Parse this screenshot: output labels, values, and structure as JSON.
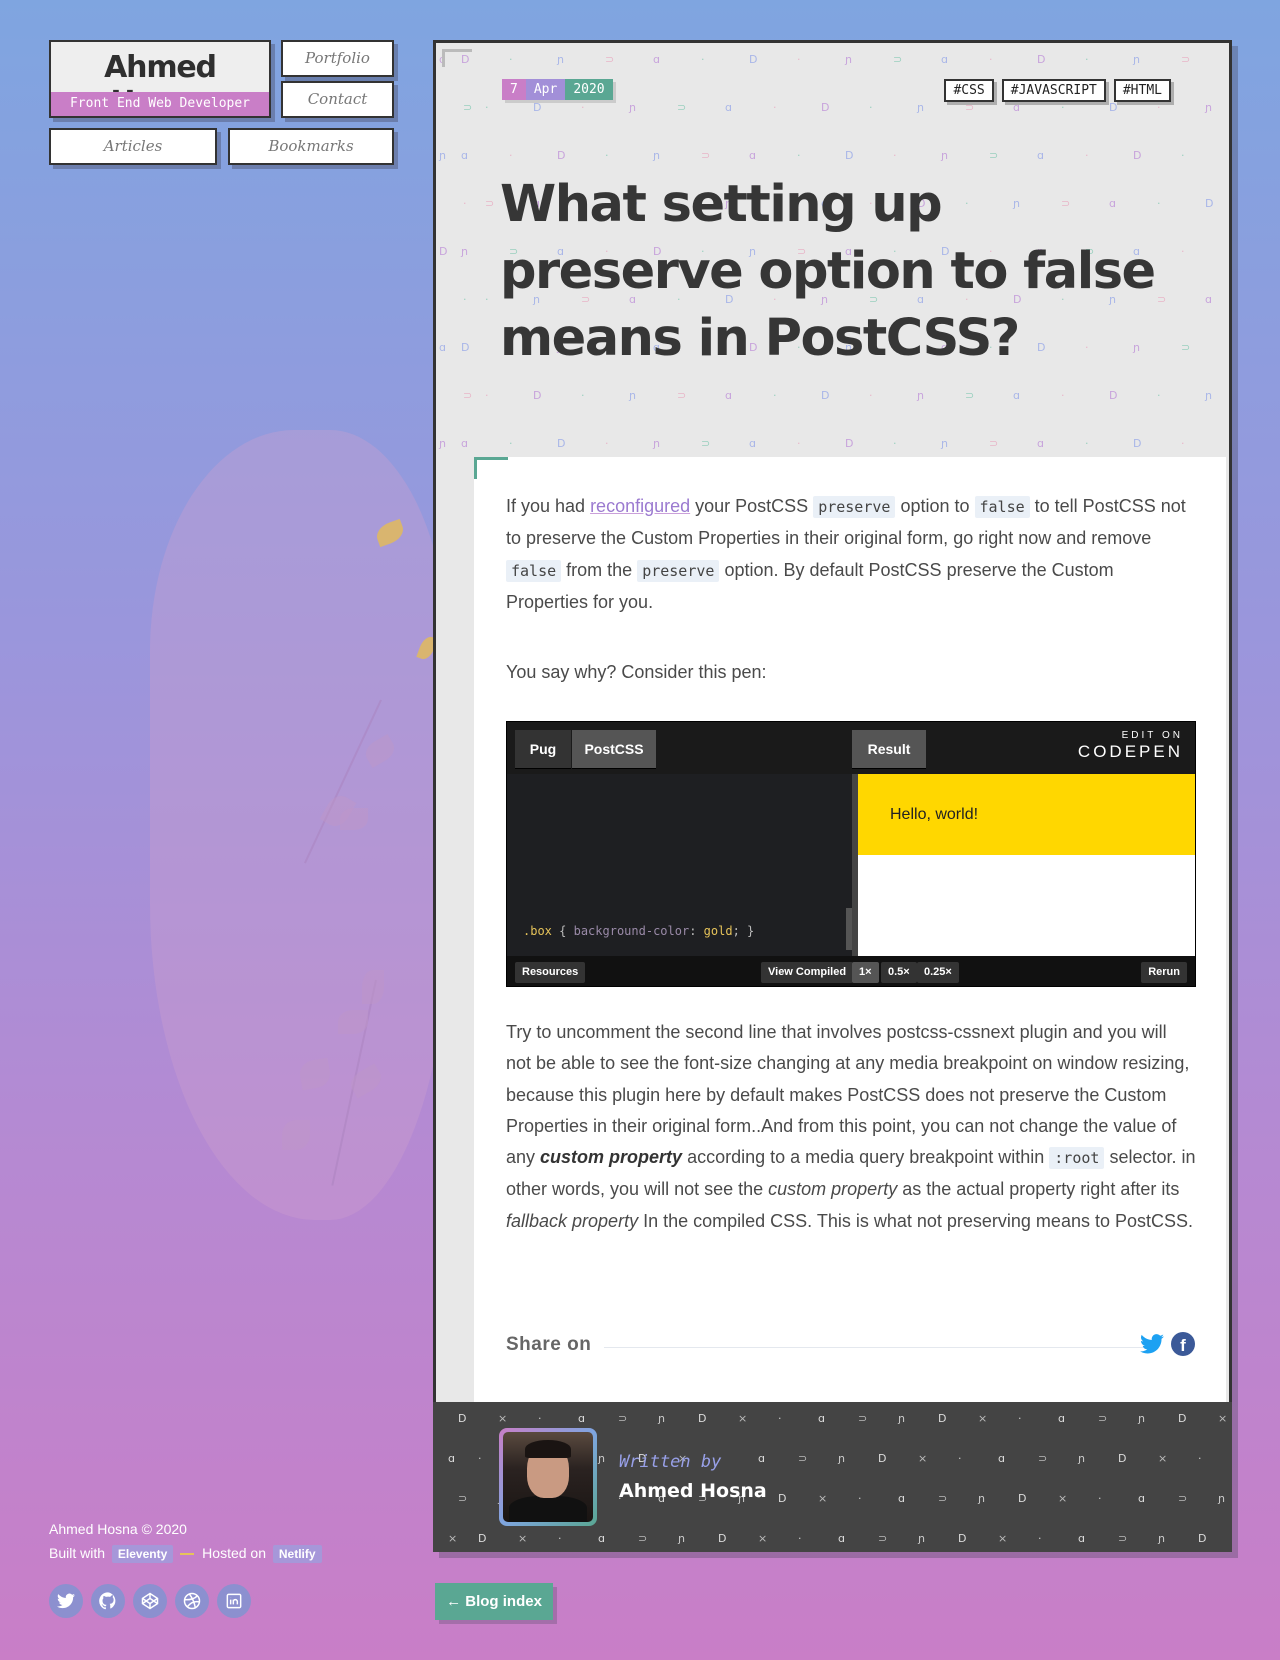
{
  "site": {
    "name": "Ahmed Hosna",
    "tagline": "Front End Web Developer",
    "nav": [
      "Portfolio",
      "Contact",
      "Articles",
      "Bookmarks"
    ]
  },
  "footer": {
    "copyright": "Ahmed Hosna © 2020",
    "built_with_label": "Built with",
    "built_with": "Eleventy",
    "hosted_label": "Hosted on",
    "hosted_on": "Netlify",
    "socials": [
      "twitter-icon",
      "github-icon",
      "codepen-icon",
      "dribbble-icon",
      "linkedin-icon"
    ]
  },
  "article": {
    "date": {
      "day": "7",
      "month": "Apr",
      "year": "2020"
    },
    "tags": [
      "#CSS",
      "#JAVASCRIPT",
      "#HTML"
    ],
    "title": "What setting up preserve option to false means in PostCSS?",
    "p1": {
      "a": "If you had ",
      "link": "reconfigured",
      "b": " your PostCSS ",
      "code1": "preserve",
      "c": " option to ",
      "code2": "false",
      "d": " to tell PostCSS not to preserve the Custom Properties in their original form, go right now and remove ",
      "code3": "false",
      "e": " from the ",
      "code4": "preserve",
      "f": " option. By default PostCSS preserve the Custom Properties for you."
    },
    "p2": "You say why? Consider this pen:",
    "p3": {
      "a": "Try to uncomment the second line that involves postcss-cssnext plugin and you will not be able to see the font-size changing at any media breakpoint on window resizing, because this plugin here by default makes PostCSS does not preserve the Custom Properties in their original form..And from this point, you can not change the value of any ",
      "strong": "custom property",
      "b": " according to a media query breakpoint within ",
      "code": ":root",
      "c": " selector. in other words, you will not see the ",
      "em1": "custom property",
      "d": " as the actual property right after its ",
      "em2": "fallback property",
      "e": " In the compiled CSS. This is what not preserving means to PostCSS."
    },
    "share_label": "Share on",
    "share_icons": [
      "twitter-icon",
      "facebook-icon"
    ]
  },
  "codepen": {
    "tabs": [
      "Pug",
      "PostCSS"
    ],
    "result_tab": "Result",
    "edit_on": "EDIT ON",
    "brand": "CODEPEN",
    "code_selector": ".box",
    "code_property": "background-color",
    "code_value": "gold",
    "result_text": "Hello, world!",
    "buttons": {
      "resources": "Resources",
      "view_compiled": "View Compiled",
      "zoom": [
        "1×",
        "0.5×",
        "0.25×"
      ],
      "rerun": "Rerun"
    }
  },
  "author": {
    "written_by": "Written by",
    "name": "Ahmed Hosna"
  },
  "blog_index": "← Blog index",
  "colors": {
    "accent_pink": "#c97ec7",
    "accent_teal": "#5aa793",
    "accent_blue": "#7fa5e0",
    "gold": "#ffd700"
  }
}
